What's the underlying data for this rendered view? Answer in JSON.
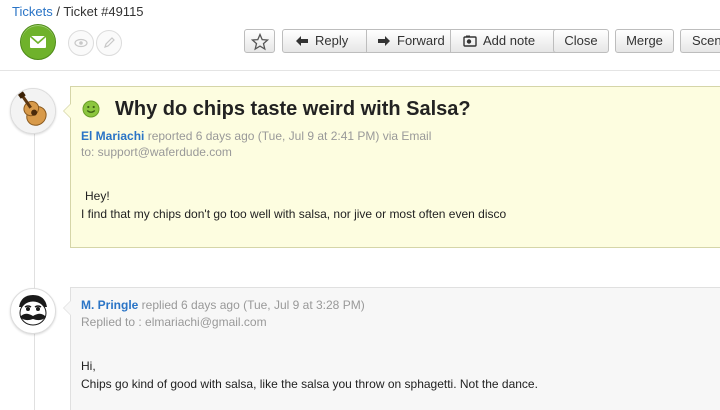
{
  "breadcrumb": {
    "parent": "Tickets",
    "separator": " / ",
    "current": "Ticket #49115"
  },
  "colors": {
    "link": "#2a74c6",
    "channel_green": "#6fb22b",
    "ticket_bg": "#fdfde0",
    "reply_bg": "#f7f7f7"
  },
  "header_icons": [
    "email-channel-icon",
    "eye-icon",
    "pencil-icon"
  ],
  "toolbar": {
    "star_icon": "star-icon",
    "reply": "Reply",
    "forward": "Forward",
    "add_note": "Add note",
    "close": "Close",
    "merge": "Merge",
    "scenarios": "Scen"
  },
  "ticket": {
    "subject": "Why do chips taste weird with Salsa?",
    "author": "El Mariachi",
    "meta": " reported 6 days ago (Tue, Jul 9 at 2:41 PM) via Email",
    "to": "to: support@waferdude.com",
    "body_line1": "Hey!",
    "body_line2": "I find that my chips don't go too well with salsa, nor jive or most often even disco"
  },
  "reply": {
    "author": "M. Pringle",
    "meta": " replied 6 days ago (Tue, Jul 9 at 3:28 PM)",
    "replied_to": "Replied to : elmariachi@gmail.com",
    "body_line1": "Hi,",
    "body_line2": "Chips go kind of good with salsa, like the salsa you throw on sphagetti. Not the dance."
  }
}
